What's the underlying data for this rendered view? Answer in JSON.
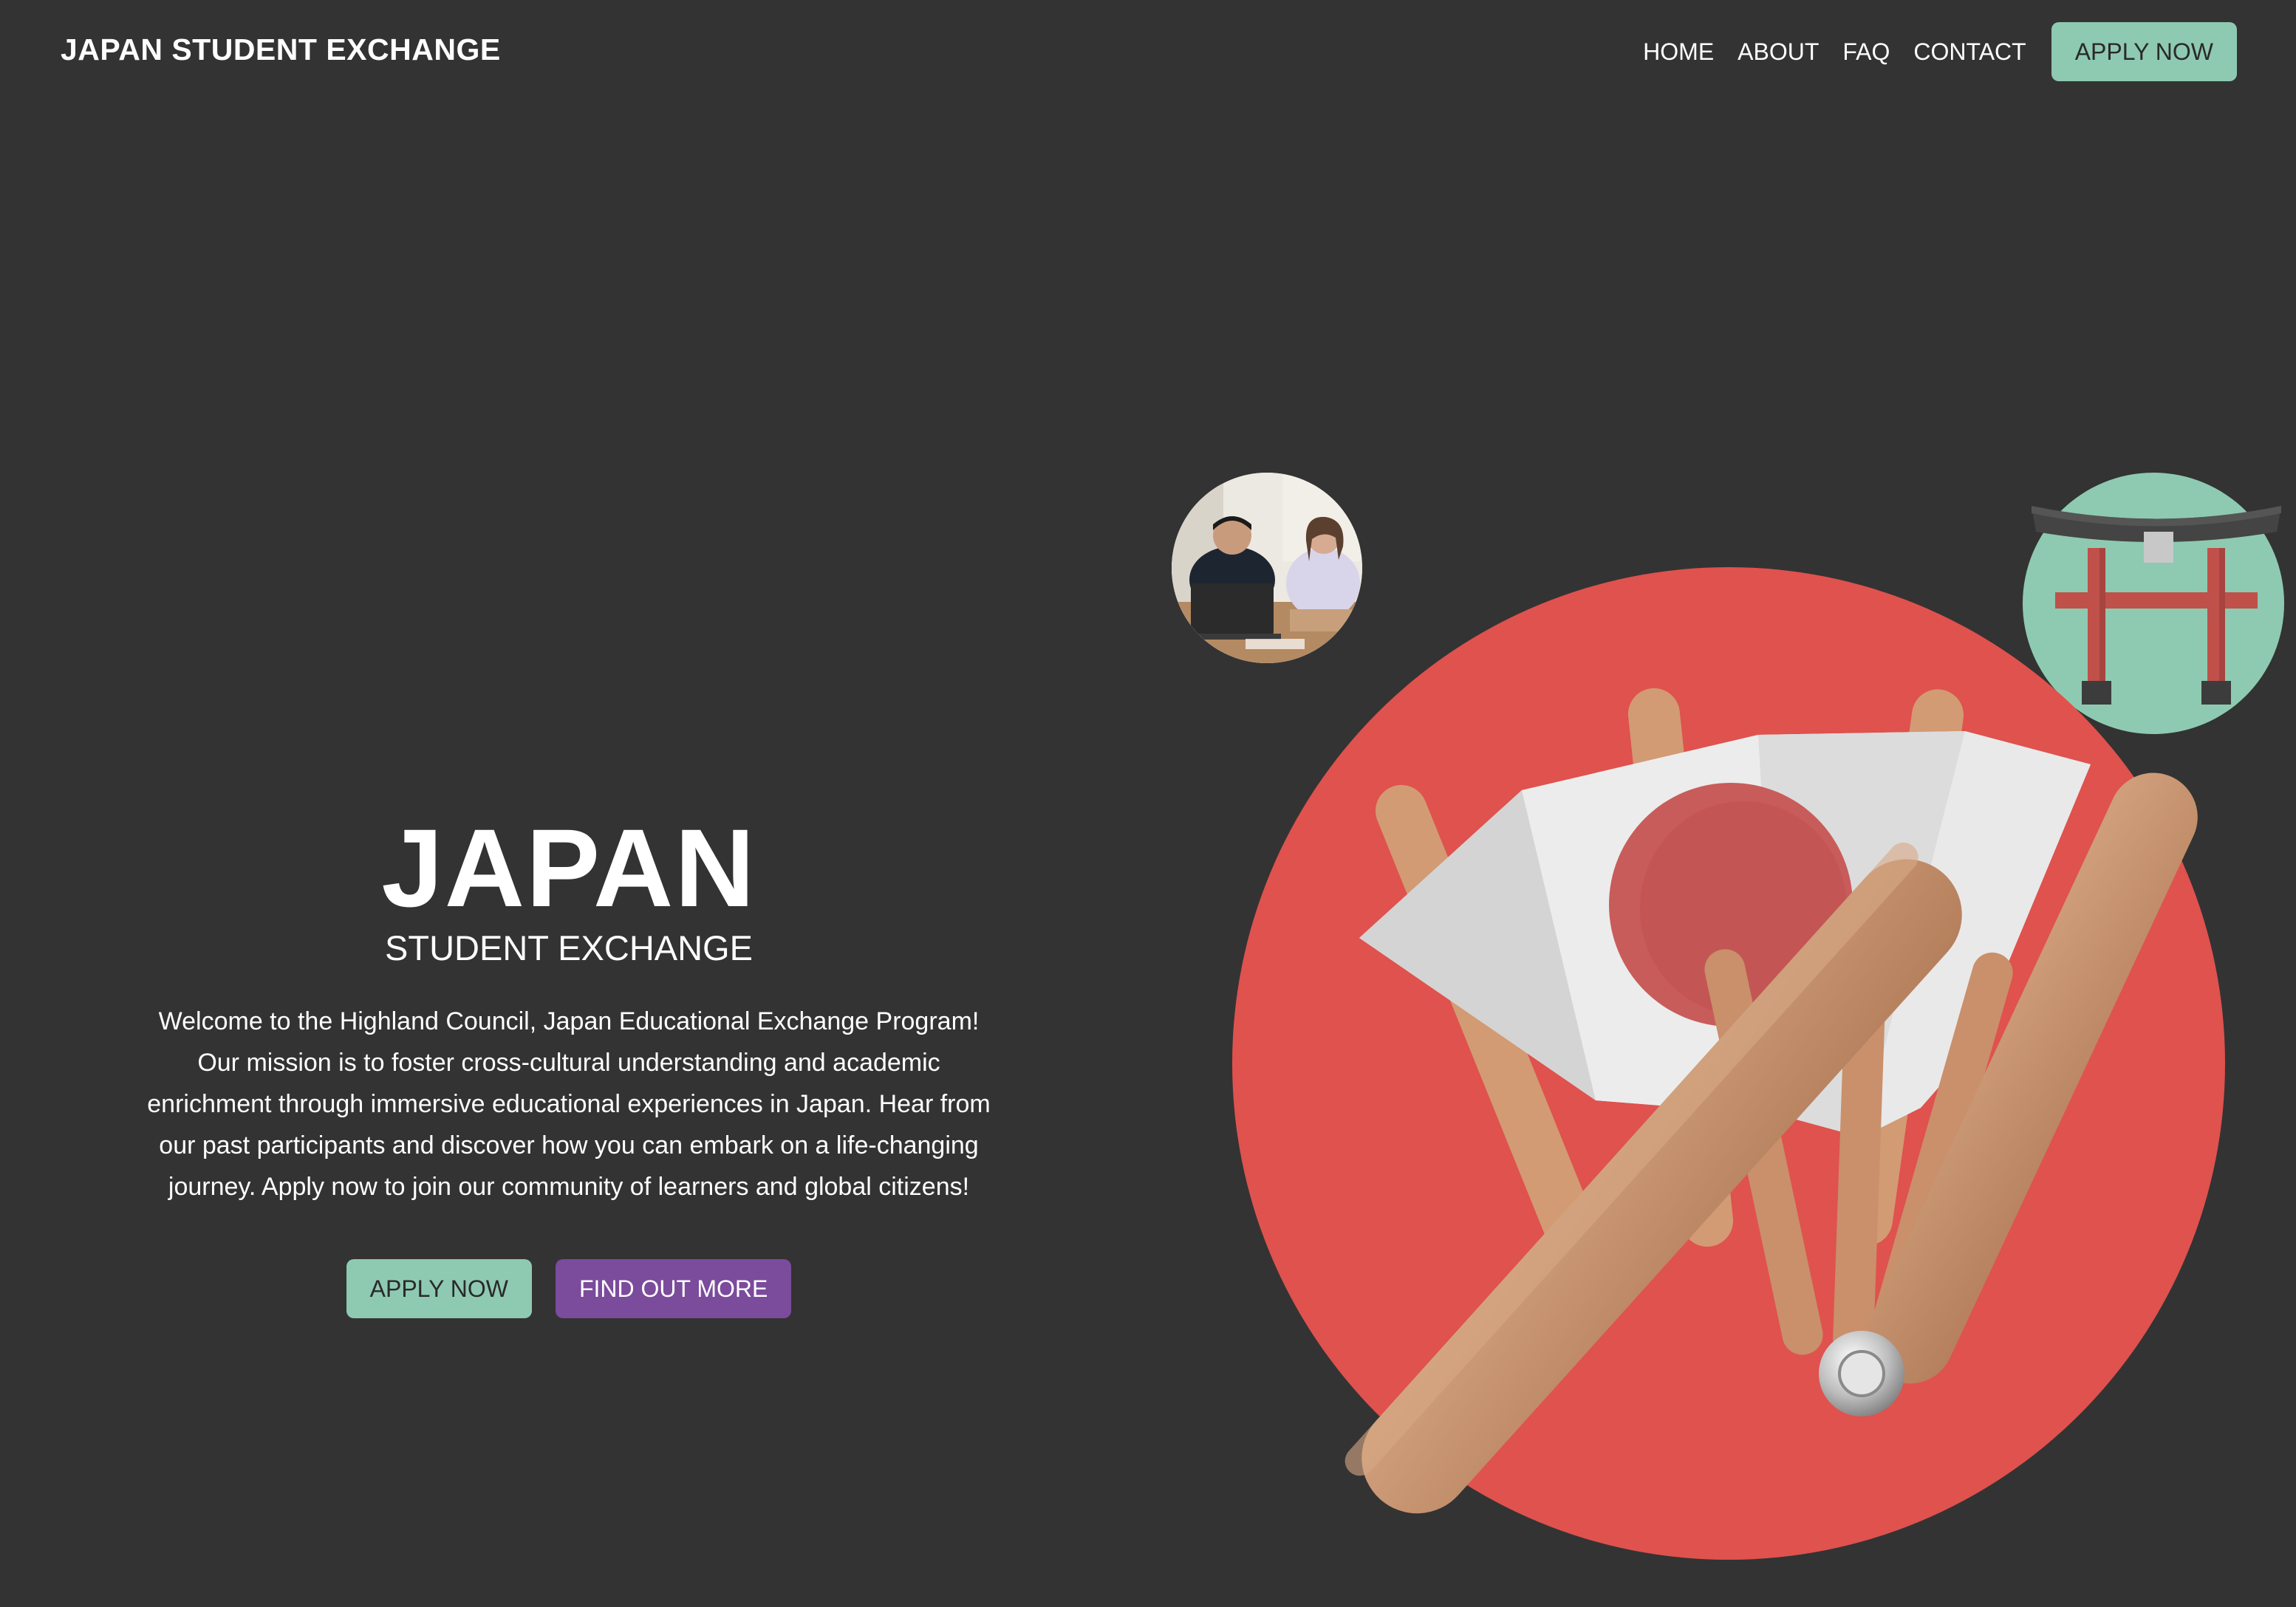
{
  "header": {
    "brand": "JAPAN STUDENT EXCHANGE",
    "nav": [
      {
        "label": "HOME"
      },
      {
        "label": "ABOUT"
      },
      {
        "label": "FAQ"
      },
      {
        "label": "CONTACT"
      }
    ],
    "apply_label": "APPLY NOW"
  },
  "hero": {
    "title": "JAPAN",
    "subtitle": "STUDENT EXCHANGE",
    "description_lines": [
      "Welcome to the Highland Council, Japan Educational Exchange Program!",
      "Our mission is to foster cross-cultural understanding and academic",
      "enrichment through immersive educational experiences in Japan. Hear from",
      "our past participants and discover how you can embark on a life-changing",
      "journey. Apply now to join our community of learners and global citizens!"
    ],
    "apply_label": "APPLY NOW",
    "more_label": "FIND OUT MORE"
  },
  "colors": {
    "background": "#333333",
    "accent_green": "#8ecab1",
    "accent_purple": "#7b4b9c",
    "japan_red": "#df524e",
    "fan_wood": "#c18e6b",
    "fan_paper": "#e8e8e8"
  },
  "icons": {
    "photo": "students-photo",
    "torii": "torii-gate-icon",
    "fan": "japanese-fan-illustration"
  }
}
